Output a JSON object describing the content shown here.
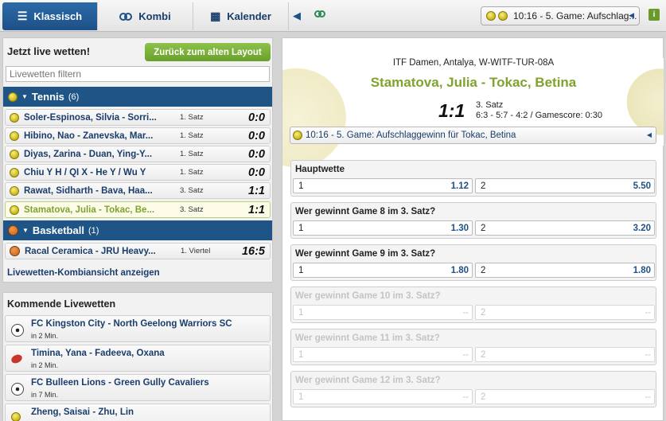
{
  "nav": {
    "tabs": [
      {
        "label": "Klassisch",
        "icon": "list-icon"
      },
      {
        "label": "Kombi",
        "icon": "rings-icon"
      },
      {
        "label": "Kalender",
        "icon": "calendar-icon"
      }
    ],
    "ticker": "10:16 - 5. Game: Aufschlag...",
    "info": "i"
  },
  "left": {
    "title": "Jetzt live wetten!",
    "old_layout_button": "Zurück zum alten Layout",
    "filter_placeholder": "Livewetten filtern",
    "sports": [
      {
        "name": "Tennis",
        "count": "(6)",
        "events": [
          {
            "name": "Soler-Espinosa, Silvia - Sorri...",
            "period": "1. Satz",
            "score": "0:0"
          },
          {
            "name": "Hibino, Nao - Zanevska, Mar...",
            "period": "1. Satz",
            "score": "0:0"
          },
          {
            "name": "Diyas, Zarina - Duan, Ying-Y...",
            "period": "1. Satz",
            "score": "0:0"
          },
          {
            "name": "Chiu Y H / QI X - He Y / Wu Y",
            "period": "1. Satz",
            "score": "0:0"
          },
          {
            "name": "Rawat, Sidharth - Bava, Haa...",
            "period": "3. Satz",
            "score": "1:1"
          },
          {
            "name": "Stamatova, Julia - Tokac, Be...",
            "period": "3. Satz",
            "score": "1:1"
          }
        ]
      },
      {
        "name": "Basketball",
        "count": "(1)",
        "events": [
          {
            "name": "Racal Ceramica - JRU Heavy...",
            "period": "1. Viertel",
            "score": "16:5"
          }
        ]
      }
    ],
    "kombi_link": "Livewetten-Kombiansicht anzeigen"
  },
  "upcoming": {
    "title": "Kommende Livewetten",
    "items": [
      {
        "name": "FC Kingston City - North Geelong Warriors SC",
        "time": "in 2 Min.",
        "icon": "soccer-icon"
      },
      {
        "name": "Timina, Yana - Fadeeva, Oxana",
        "time": "in 2 Min.",
        "icon": "table-tennis-icon"
      },
      {
        "name": "FC Bulleen Lions - Green Gully Cavaliers",
        "time": "in 7 Min.",
        "icon": "soccer-icon"
      },
      {
        "name": "Zheng, Saisai - Zhu, Lin",
        "time": "",
        "icon": "tennis-icon"
      }
    ]
  },
  "event": {
    "league": "ITF Damen, Antalya, W-WITF-TUR-08A",
    "title": "Stamatova, Julia - Tokac, Betina",
    "score": "1:1",
    "set": "3. Satz",
    "sets_detail": "6:3 - 5:7 - 4:2 / Gamescore: 0:30",
    "ticker": "10:16 - 5. Game: Aufschlaggewinn für Tokac, Betina"
  },
  "markets": [
    {
      "title": "Hauptwette",
      "odds": [
        {
          "label": "1",
          "value": "1.12"
        },
        {
          "label": "2",
          "value": "5.50"
        }
      ],
      "disabled": false
    },
    {
      "title": "Wer gewinnt Game 8 im 3. Satz?",
      "odds": [
        {
          "label": "1",
          "value": "1.30"
        },
        {
          "label": "2",
          "value": "3.20"
        }
      ],
      "disabled": false
    },
    {
      "title": "Wer gewinnt Game 9 im 3. Satz?",
      "odds": [
        {
          "label": "1",
          "value": "1.80"
        },
        {
          "label": "2",
          "value": "1.80"
        }
      ],
      "disabled": false
    },
    {
      "title": "Wer gewinnt Game 10 im 3. Satz?",
      "odds": [
        {
          "label": "1",
          "value": "--"
        },
        {
          "label": "2",
          "value": "--"
        }
      ],
      "disabled": true
    },
    {
      "title": "Wer gewinnt Game 11 im 3. Satz?",
      "odds": [
        {
          "label": "1",
          "value": "--"
        },
        {
          "label": "2",
          "value": "--"
        }
      ],
      "disabled": true
    },
    {
      "title": "Wer gewinnt Game 12 im 3. Satz?",
      "odds": [
        {
          "label": "1",
          "value": "--"
        },
        {
          "label": "2",
          "value": "--"
        }
      ],
      "disabled": true
    }
  ]
}
